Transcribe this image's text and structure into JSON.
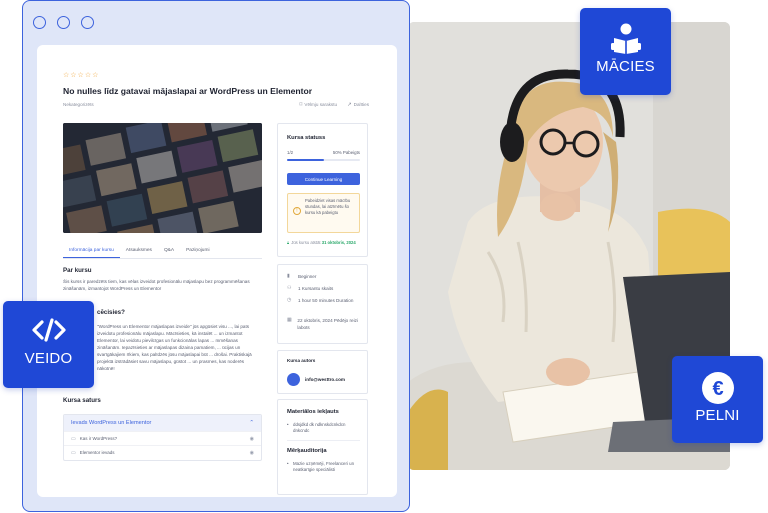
{
  "course": {
    "stars": "☆☆☆☆☆",
    "title": "No nulles līdz gatavai mājaslapai ar WordPress un Elementor",
    "category": "Nekategorizēts",
    "wishlist_label": "Vēlmju sarakstu",
    "share_label": "Dalīties",
    "tabs": [
      "Informācija par kursu",
      "Atsauksmes",
      "Q&A",
      "Paziņojumi"
    ],
    "about_heading": "Par kursu",
    "about_text": "Šis kurss ir paredzēts tiem, kas vēlas izveidot profesionālu mājaslapu bez programmēšanas zināšanām, izmantojot WordPress un Elementor",
    "why_heading": "cēcisies?",
    "why_text": "\"WordPress un Elementor mājaslapas izveide\" jūs apgūsiet visu ..., lai pats izveidotu profesionālu mājaslapu. Mācīsieties, kā instalēt ... un izmantot Elementor, lai veidotu pievilcīgas un funkcionālas lapas ... mmēšanas zināšanām. Iepazīsieties ar mājaslapas dizaina pamatiem, ... ūcijas un svarīgākajiem rīkiem, kas palīdzēs jūsu mājaslapai būt ... drošai. Praktiskajā projektā izstrādāsiet savu mājaslapu, gūstot ... un prasmes, kas noderēs nākotnē!",
    "content_heading": "Kursa saturs",
    "section_title": "Ievads WordPress un Elementor",
    "lessons": [
      "Kas ir WordPress?",
      "Elementor ievads"
    ]
  },
  "sidebar": {
    "status_title": "Kursa statuss",
    "progress_left": "1/2",
    "progress_right": "50% Pabeigts",
    "progress_fraction": 0.5,
    "continue_label": "Continue Learning",
    "notice": "Pabeidziet visas mācību stundas, lai atzīmētu šo kursu kā pabeigtu",
    "access_prefix": "Jūs kursu atstāt",
    "access_date": "31 oktobris, 2024",
    "meta": [
      {
        "icon": "level-icon",
        "text": "Beginner"
      },
      {
        "icon": "students-icon",
        "text": "1 Kursantu skaits"
      },
      {
        "icon": "clock-icon",
        "text": "1 hour  50 minutes Duration"
      },
      {
        "icon": "calendar-icon",
        "text": "22 oktobris, 2024 Pēdējo reizi labots"
      }
    ],
    "author_label": "Kursa autors",
    "author_email": "info@westtro.com",
    "materials_heading": "Materiālos iekļauts",
    "materials_item": "ddsjdkd dk ndknskdcnkdcn dnkcndc",
    "audience_heading": "Mērķauditorija",
    "audience_item": "Mazie uzņēmēji, Freelanceri un neatkarīgie speciālisti"
  },
  "badges": {
    "learn": "MĀCIES",
    "create": "VEIDO",
    "earn": "PELNI"
  },
  "colors": {
    "accent": "#3d63dd",
    "badge": "#1f48d6",
    "success": "#2aa86a",
    "star": "#f0a63a"
  }
}
